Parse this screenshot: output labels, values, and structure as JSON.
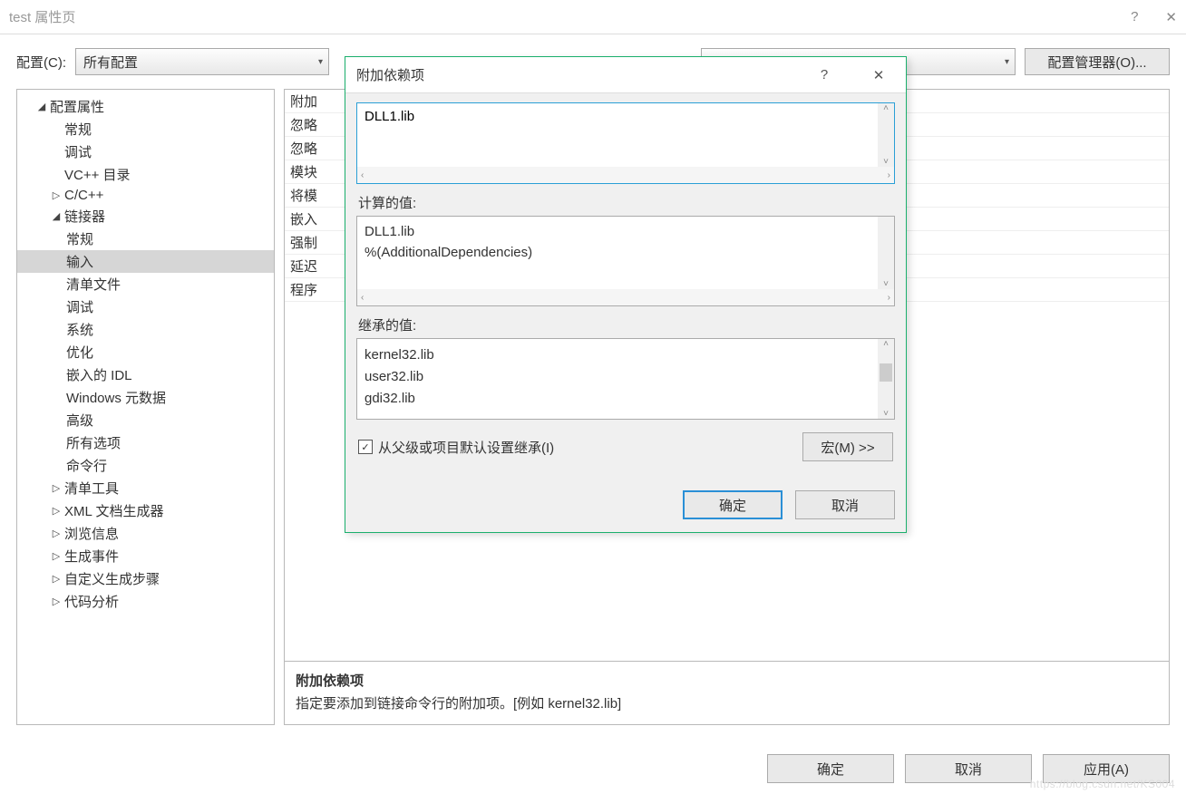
{
  "window": {
    "title": "test 属性页",
    "help_icon": "?",
    "close_icon": "✕"
  },
  "config_row": {
    "label": "配置(C):",
    "dropdown_value": "所有配置",
    "config_mgr": "配置管理器(O)..."
  },
  "tree": {
    "root": "配置属性",
    "items_l2_a": [
      "常规",
      "调试",
      "VC++ 目录"
    ],
    "cpp": "C/C++",
    "linker": "链接器",
    "linker_children": [
      "常规",
      "输入",
      "清单文件",
      "调试",
      "系统",
      "优化",
      "嵌入的 IDL",
      "Windows 元数据",
      "高级",
      "所有选项",
      "命令行"
    ],
    "selected": "输入",
    "tail": [
      "清单工具",
      "XML 文档生成器",
      "浏览信息",
      "生成事件",
      "自定义生成步骤",
      "代码分析"
    ]
  },
  "props": {
    "rows": [
      "附加",
      "忽略",
      "忽略",
      "模块",
      "将模",
      "嵌入",
      "强制",
      "延迟",
      "程序"
    ]
  },
  "desc": {
    "title": "附加依赖项",
    "text": "指定要添加到链接命令行的附加项。[例如 kernel32.lib]"
  },
  "bottom_buttons": {
    "ok": "确定",
    "cancel": "取消",
    "apply": "应用(A)"
  },
  "modal": {
    "title": "附加依赖项",
    "help_icon": "?",
    "close_icon": "✕",
    "edit_value": "DLL1.lib",
    "computed_label": "计算的值:",
    "computed_values": [
      "DLL1.lib",
      "%(AdditionalDependencies)"
    ],
    "inherited_label": "继承的值:",
    "inherited_values": [
      "kernel32.lib",
      "user32.lib",
      "gdi32.lib"
    ],
    "inherit_checkbox": "从父级或项目默认设置继承(I)",
    "inherit_checked": true,
    "macro_btn": "宏(M) >>",
    "ok": "确定",
    "cancel": "取消"
  },
  "watermark": "https://blog.csdn.net/KS004"
}
